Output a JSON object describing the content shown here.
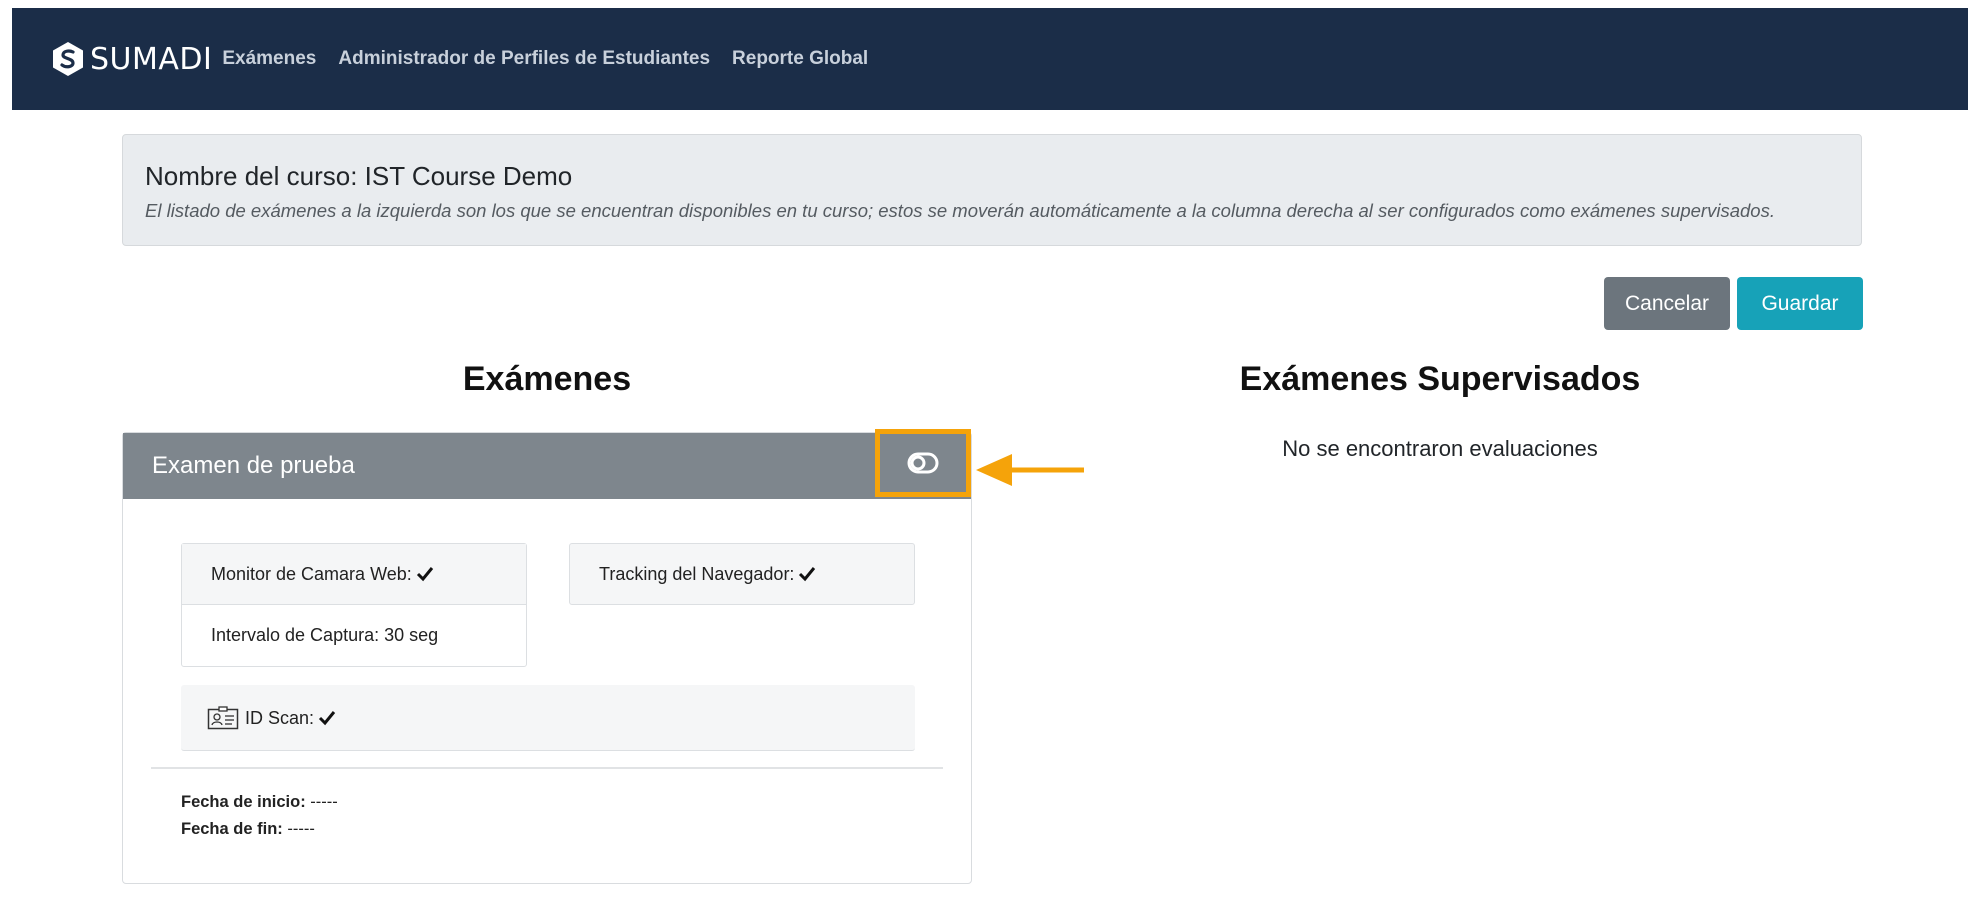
{
  "navbar": {
    "brand": "SUMADI",
    "links": [
      "Exámenes",
      "Administrador de Perfiles de Estudiantes",
      "Reporte Global"
    ]
  },
  "course": {
    "title": "Nombre del curso: IST Course Demo",
    "description": "El listado de exámenes a la izquierda son los que se encuentran disponibles en tu curso; estos se moverán automáticamente a la columna derecha al ser configurados como exámenes supervisados."
  },
  "actions": {
    "cancel": "Cancelar",
    "save": "Guardar"
  },
  "columns": {
    "left_title": "Exámenes",
    "right_title": "Exámenes Supervisados",
    "right_empty": "No se encontraron evaluaciones"
  },
  "exam": {
    "name": "Examen de prueba",
    "webcam_label": "Monitor de Camara Web:",
    "capture_interval": "Intervalo de Captura: 30 seg",
    "tracking_label": "Tracking del Navegador:",
    "idscan_label": "ID Scan:",
    "start_label": "Fecha de inicio:",
    "start_value": " -----",
    "end_label": "Fecha de fin:",
    "end_value": " -----"
  },
  "colors": {
    "navbar": "#1b2d48",
    "cancel": "#6c757d",
    "save": "#17a2b8",
    "exam_header": "#7e868d",
    "highlight": "#f5a30a"
  }
}
